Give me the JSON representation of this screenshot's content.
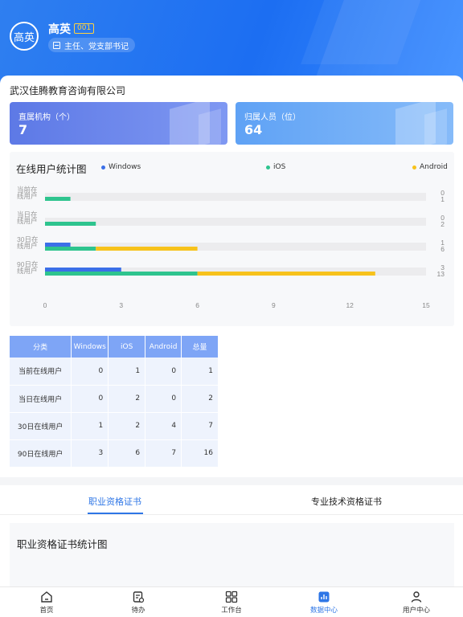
{
  "user": {
    "avatar_text": "高英",
    "name": "高英",
    "code": "001",
    "role": "主任、党支部书记"
  },
  "company": "武汉佳腾教育咨询有限公司",
  "stats": [
    {
      "label": "直属机构（个）",
      "value": "7"
    },
    {
      "label": "归属人员（位）",
      "value": "64"
    }
  ],
  "chart_data": {
    "type": "bar",
    "title": "在线用户统计图",
    "categories": [
      "当前在线用户",
      "当日在线用户",
      "30日在线用户",
      "90日在线用户"
    ],
    "category_lines": [
      [
        "当前在",
        "线用户"
      ],
      [
        "当日在",
        "线用户"
      ],
      [
        "30日在",
        "线用户"
      ],
      [
        "90日在",
        "线用户"
      ]
    ],
    "series": [
      {
        "name": "Windows",
        "values": [
          0,
          0,
          1,
          3
        ],
        "color": "#3b6fe8"
      },
      {
        "name": "iOS",
        "values": [
          1,
          2,
          2,
          6
        ],
        "color": "#2ec48e"
      },
      {
        "name": "Android",
        "values": [
          0,
          0,
          4,
          7
        ],
        "color": "#f7c21b"
      }
    ],
    "right_labels": [
      [
        "0",
        "1"
      ],
      [
        "0",
        "2"
      ],
      [
        "1",
        "6"
      ],
      [
        "3",
        "13"
      ]
    ],
    "xticks": [
      "0",
      "3",
      "6",
      "9",
      "12",
      "15"
    ],
    "xlim": [
      0,
      15
    ],
    "orientation": "horizontal",
    "stacking": "windows separate; iOS and Android stacked",
    "legend": "top"
  },
  "table": {
    "headers": [
      "分类",
      "Windows",
      "iOS",
      "Android",
      "总量"
    ],
    "rows": [
      [
        "当前在线用户",
        "0",
        "1",
        "0",
        "1"
      ],
      [
        "当日在线用户",
        "0",
        "2",
        "0",
        "2"
      ],
      [
        "30日在线用户",
        "1",
        "2",
        "4",
        "7"
      ],
      [
        "90日在线用户",
        "3",
        "6",
        "7",
        "16"
      ]
    ]
  },
  "tabs": [
    {
      "label": "职业资格证书",
      "active": true
    },
    {
      "label": "专业技术资格证书",
      "active": false
    }
  ],
  "section2_title": "职业资格证书统计图",
  "tabbar": [
    {
      "label": "首页",
      "icon": "home-icon",
      "active": false
    },
    {
      "label": "待办",
      "icon": "todo-icon",
      "active": false
    },
    {
      "label": "工作台",
      "icon": "grid-icon",
      "active": false
    },
    {
      "label": "数据中心",
      "icon": "chart-icon",
      "active": true
    },
    {
      "label": "用户中心",
      "icon": "user-icon",
      "active": false
    }
  ],
  "colors": {
    "primary": "#2e76e6",
    "header": "#1c6ef2"
  }
}
